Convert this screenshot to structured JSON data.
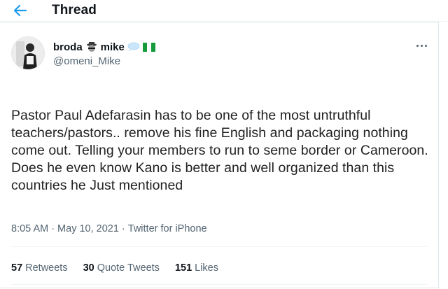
{
  "header": {
    "title": "Thread",
    "back_icon": "arrow-left-icon",
    "accent_color": "#1d9bf0"
  },
  "tweet": {
    "author": {
      "display_name_part1": "broda",
      "display_name_part2": "mike",
      "emoji_icons": [
        "spy-face-icon",
        "speech-balloon-icon",
        "nigeria-flag-icon"
      ],
      "handle": "@omeni_Mike"
    },
    "text": "Pastor Paul Adefarasin has to be one of the most untruthful teachers/pastors.. remove his fine English and packaging nothing come out. Telling your members to run to seme border or Cameroon. Does he even know Kano is better and well organized than this countries he Just mentioned",
    "time": "8:05 AM",
    "separator": "·",
    "date": "May 10, 2021",
    "source": "Twitter for iPhone",
    "stats": {
      "retweets_count": "57",
      "retweets_label": "Retweets",
      "quotes_count": "30",
      "quotes_label": "Quote Tweets",
      "likes_count": "151",
      "likes_label": "Likes"
    }
  }
}
